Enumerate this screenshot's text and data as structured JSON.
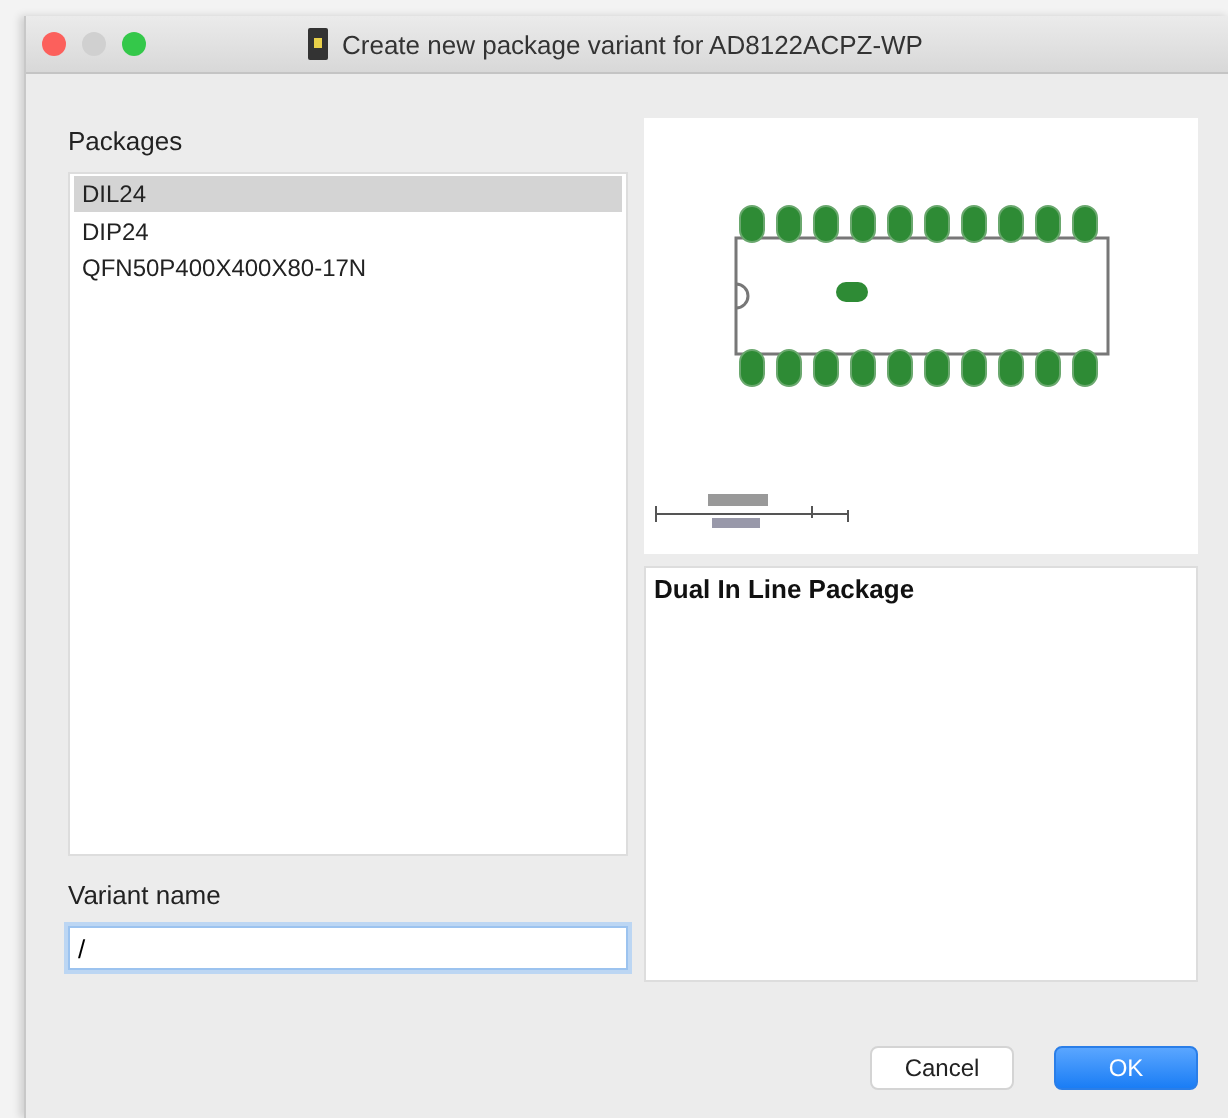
{
  "window": {
    "title": "Create new package variant for AD8122ACPZ-WP"
  },
  "packages": {
    "label": "Packages",
    "items": [
      {
        "label": "DIL24",
        "selected": true
      },
      {
        "label": "DIP24",
        "selected": false
      },
      {
        "label": "QFN50P400X400X80-17N",
        "selected": false
      }
    ]
  },
  "variant_name": {
    "label": "Variant name",
    "value": "/"
  },
  "description": "Dual In Line Package",
  "buttons": [
    {
      "label": "Cancel",
      "kind": "secondary"
    },
    {
      "label": "OK",
      "kind": "primary"
    }
  ]
}
